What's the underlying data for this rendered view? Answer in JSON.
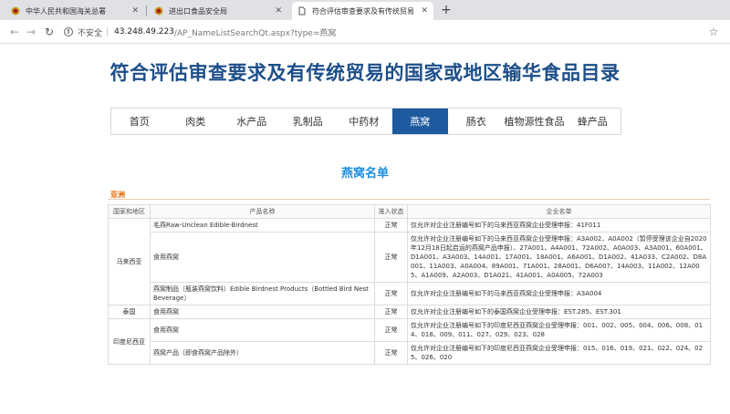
{
  "browser": {
    "tabs": [
      {
        "title": "中华人民共和国海关总署",
        "active": false
      },
      {
        "title": "进出口食品安全局",
        "active": false
      },
      {
        "title": "符合评估审查要求及有传统贸易",
        "active": true
      }
    ],
    "address": {
      "not_secure": "不安全",
      "host": "43.248.49.223",
      "path": "/AP_NameListSearchQt.aspx?type=燕窝"
    }
  },
  "page": {
    "title": "符合评估审查要求及有传统贸易的国家或地区输华食品目录",
    "nav": [
      "首页",
      "肉类",
      "水产品",
      "乳制品",
      "中药材",
      "燕窝",
      "肠衣",
      "植物源性食品",
      "蜂产品"
    ],
    "nav_active_index": 5,
    "list_title": "燕窝名单",
    "region": "亚洲",
    "table": {
      "headers": [
        "国家和地区",
        "产品名称",
        "准入状态",
        "企业名单"
      ],
      "rows": [
        {
          "country": "马来西亚",
          "rowspan": 3,
          "product": "毛燕Raw-Unclean Edible-Birdnest",
          "status": "正常",
          "company": "仅允许对企业注册编号如下的马来西亚燕窝企业受理申报：41F011"
        },
        {
          "product": "食用燕窝",
          "status": "正常",
          "company": "仅允许对企业注册编号如下的马来西亚燕窝企业受理申报：A3A002、A0A002（暂停受理该企业自2020年12月18日起启运的燕窝产品申报）、27A001、A4A001、72A002、A0A003、A3A001、60A001、D1A001、A3A003、14A001、17A001、18A001、A6A001、D1A002、41A033、C2A002、D8A001、11A003、A0A004、89A001、71A001、28A001、D6A007、14A003、11A002、12A005、A1A009、A2A003、D1A021、41A001、A0A005、72A003"
        },
        {
          "product": "燕窝制品（瓶装燕窝饮料）Edible Birdnest Products（Bottled Bird Nest Beverage）",
          "status": "正常",
          "company": "仅允许对企业注册编号如下的马来西亚燕窝企业受理申报：A3A004"
        },
        {
          "country": "泰国",
          "rowspan": 1,
          "product": "食用燕窝",
          "status": "正常",
          "company": "仅允许对企业注册编号如下的泰国燕窝企业受理申报：EST.285、EST.301"
        },
        {
          "country": "印度尼西亚",
          "rowspan": 2,
          "product": "食用燕窝",
          "status": "正常",
          "company": "仅允许对企业注册编号如下的印度尼西亚燕窝企业受理申报：001、002、005、004、006、008、014、018、009、011、027、029、023、028"
        },
        {
          "product": "燕窝产品（即食燕窝产品除外）",
          "status": "正常",
          "company": "仅允许对企业注册编号如下的印度尼西亚燕窝企业受理申报：015、016、019、021、022、024、025、026、020"
        }
      ]
    }
  }
}
